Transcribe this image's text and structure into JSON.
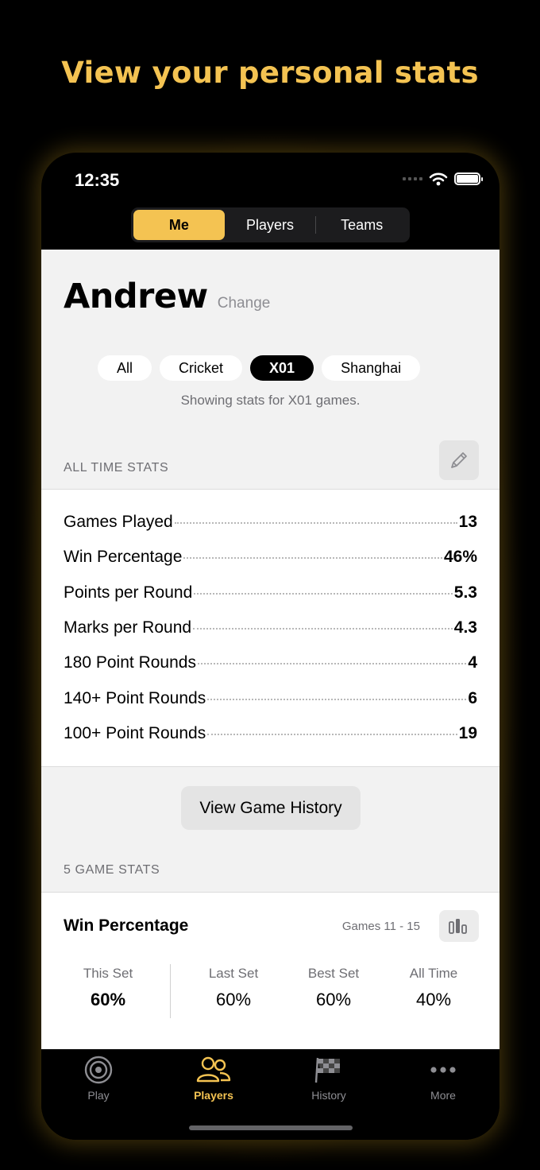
{
  "headline": "View your personal stats",
  "status_bar": {
    "time": "12:35"
  },
  "segments": [
    {
      "label": "Me",
      "active": true
    },
    {
      "label": "Players",
      "active": false
    },
    {
      "label": "Teams",
      "active": false
    }
  ],
  "profile": {
    "name": "Andrew",
    "change_label": "Change"
  },
  "filters": [
    {
      "label": "All",
      "active": false
    },
    {
      "label": "Cricket",
      "active": false
    },
    {
      "label": "X01",
      "active": true
    },
    {
      "label": "Shanghai",
      "active": false
    }
  ],
  "filter_note": "Showing stats for X01 games.",
  "all_time": {
    "heading": "ALL TIME STATS",
    "rows": [
      {
        "label": "Games Played",
        "value": "13"
      },
      {
        "label": "Win Percentage",
        "value": "46%"
      },
      {
        "label": "Points per Round",
        "value": "5.3"
      },
      {
        "label": "Marks per Round",
        "value": "4.3"
      },
      {
        "label": "180 Point Rounds",
        "value": "4"
      },
      {
        "label": "140+ Point Rounds",
        "value": "6"
      },
      {
        "label": "100+ Point Rounds",
        "value": "19"
      }
    ]
  },
  "history_button": "View Game History",
  "five_game": {
    "heading": "5 GAME STATS",
    "title": "Win Percentage",
    "range": "Games 11 - 15",
    "columns": [
      {
        "label": "This Set",
        "value": "60%"
      },
      {
        "label": "Last Set",
        "value": "60%"
      },
      {
        "label": "Best Set",
        "value": "60%"
      },
      {
        "label": "All Time",
        "value": "40%"
      }
    ]
  },
  "tabs": [
    {
      "label": "Play",
      "icon": "target-icon",
      "active": false
    },
    {
      "label": "Players",
      "icon": "people-icon",
      "active": true
    },
    {
      "label": "History",
      "icon": "checkered-flag-icon",
      "active": false
    },
    {
      "label": "More",
      "icon": "ellipsis-icon",
      "active": false
    }
  ],
  "colors": {
    "accent": "#f4c352",
    "background": "#000000",
    "content": "#f2f2f2"
  }
}
